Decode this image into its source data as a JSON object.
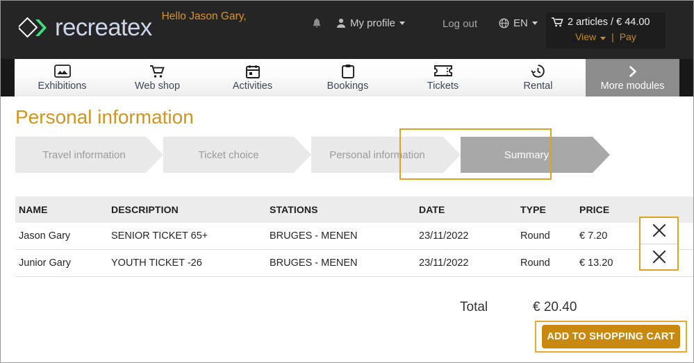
{
  "header": {
    "brand_name": "recreatex",
    "logo_icon": "diamond-chevron-logo",
    "greeting": "Hello Jason Gary,",
    "bell_icon": "notification-bell-icon",
    "profile_icon": "user-icon",
    "profile_label": "My profile",
    "logout_label": "Log out",
    "globe_icon": "globe-icon",
    "language": "EN",
    "cart_icon": "shopping-cart-icon",
    "cart_summary": "2 articles / € 44.00",
    "cart_view_label": "View",
    "cart_separator": "|",
    "cart_pay_label": "Pay"
  },
  "nav": {
    "items": [
      {
        "label": "Exhibitions",
        "icon": "image-picture-icon"
      },
      {
        "label": "Web shop",
        "icon": "shopping-cart-icon"
      },
      {
        "label": "Activities",
        "icon": "calendar-icon"
      },
      {
        "label": "Bookings",
        "icon": "clipboard-icon"
      },
      {
        "label": "Tickets",
        "icon": "ticket-icon"
      },
      {
        "label": "Rental",
        "icon": "clock-history-icon"
      },
      {
        "label": "More modules",
        "icon": "chevron-right-icon"
      }
    ]
  },
  "main": {
    "page_title": "Personal information",
    "steps": [
      {
        "label": "Travel information",
        "active": false
      },
      {
        "label": "Ticket choice",
        "active": false
      },
      {
        "label": "Personal information",
        "active": false
      },
      {
        "label": "Summary",
        "active": true
      }
    ],
    "table": {
      "columns": [
        "NAME",
        "DESCRIPTION",
        "STATIONS",
        "DATE",
        "TYPE",
        "PRICE"
      ],
      "rows": [
        {
          "name": "Jason Gary",
          "description": "SENIOR TICKET 65+",
          "stations": "BRUGES - MENEN",
          "date": "23/11/2022",
          "type": "Round",
          "price": "€ 7.20",
          "delete_icon": "close-x-icon"
        },
        {
          "name": "Junior Gary",
          "description": "YOUTH TICKET -26",
          "stations": "BRUGES - MENEN",
          "date": "23/11/2022",
          "type": "Round",
          "price": "€ 13.20",
          "delete_icon": "close-x-icon"
        }
      ]
    },
    "total_label": "Total",
    "total_value": "€ 20.40",
    "cta_label": "ADD TO SHOPPING CART"
  },
  "colors": {
    "accent_orange": "#d4941b",
    "focus_orange": "#e0a020",
    "cta_gold": "#c9880f",
    "header_dark": "#252525",
    "step_active_gray": "#a8a8a8",
    "step_inactive_gray": "#e9e9e9",
    "logo_green": "#3ee07f"
  }
}
